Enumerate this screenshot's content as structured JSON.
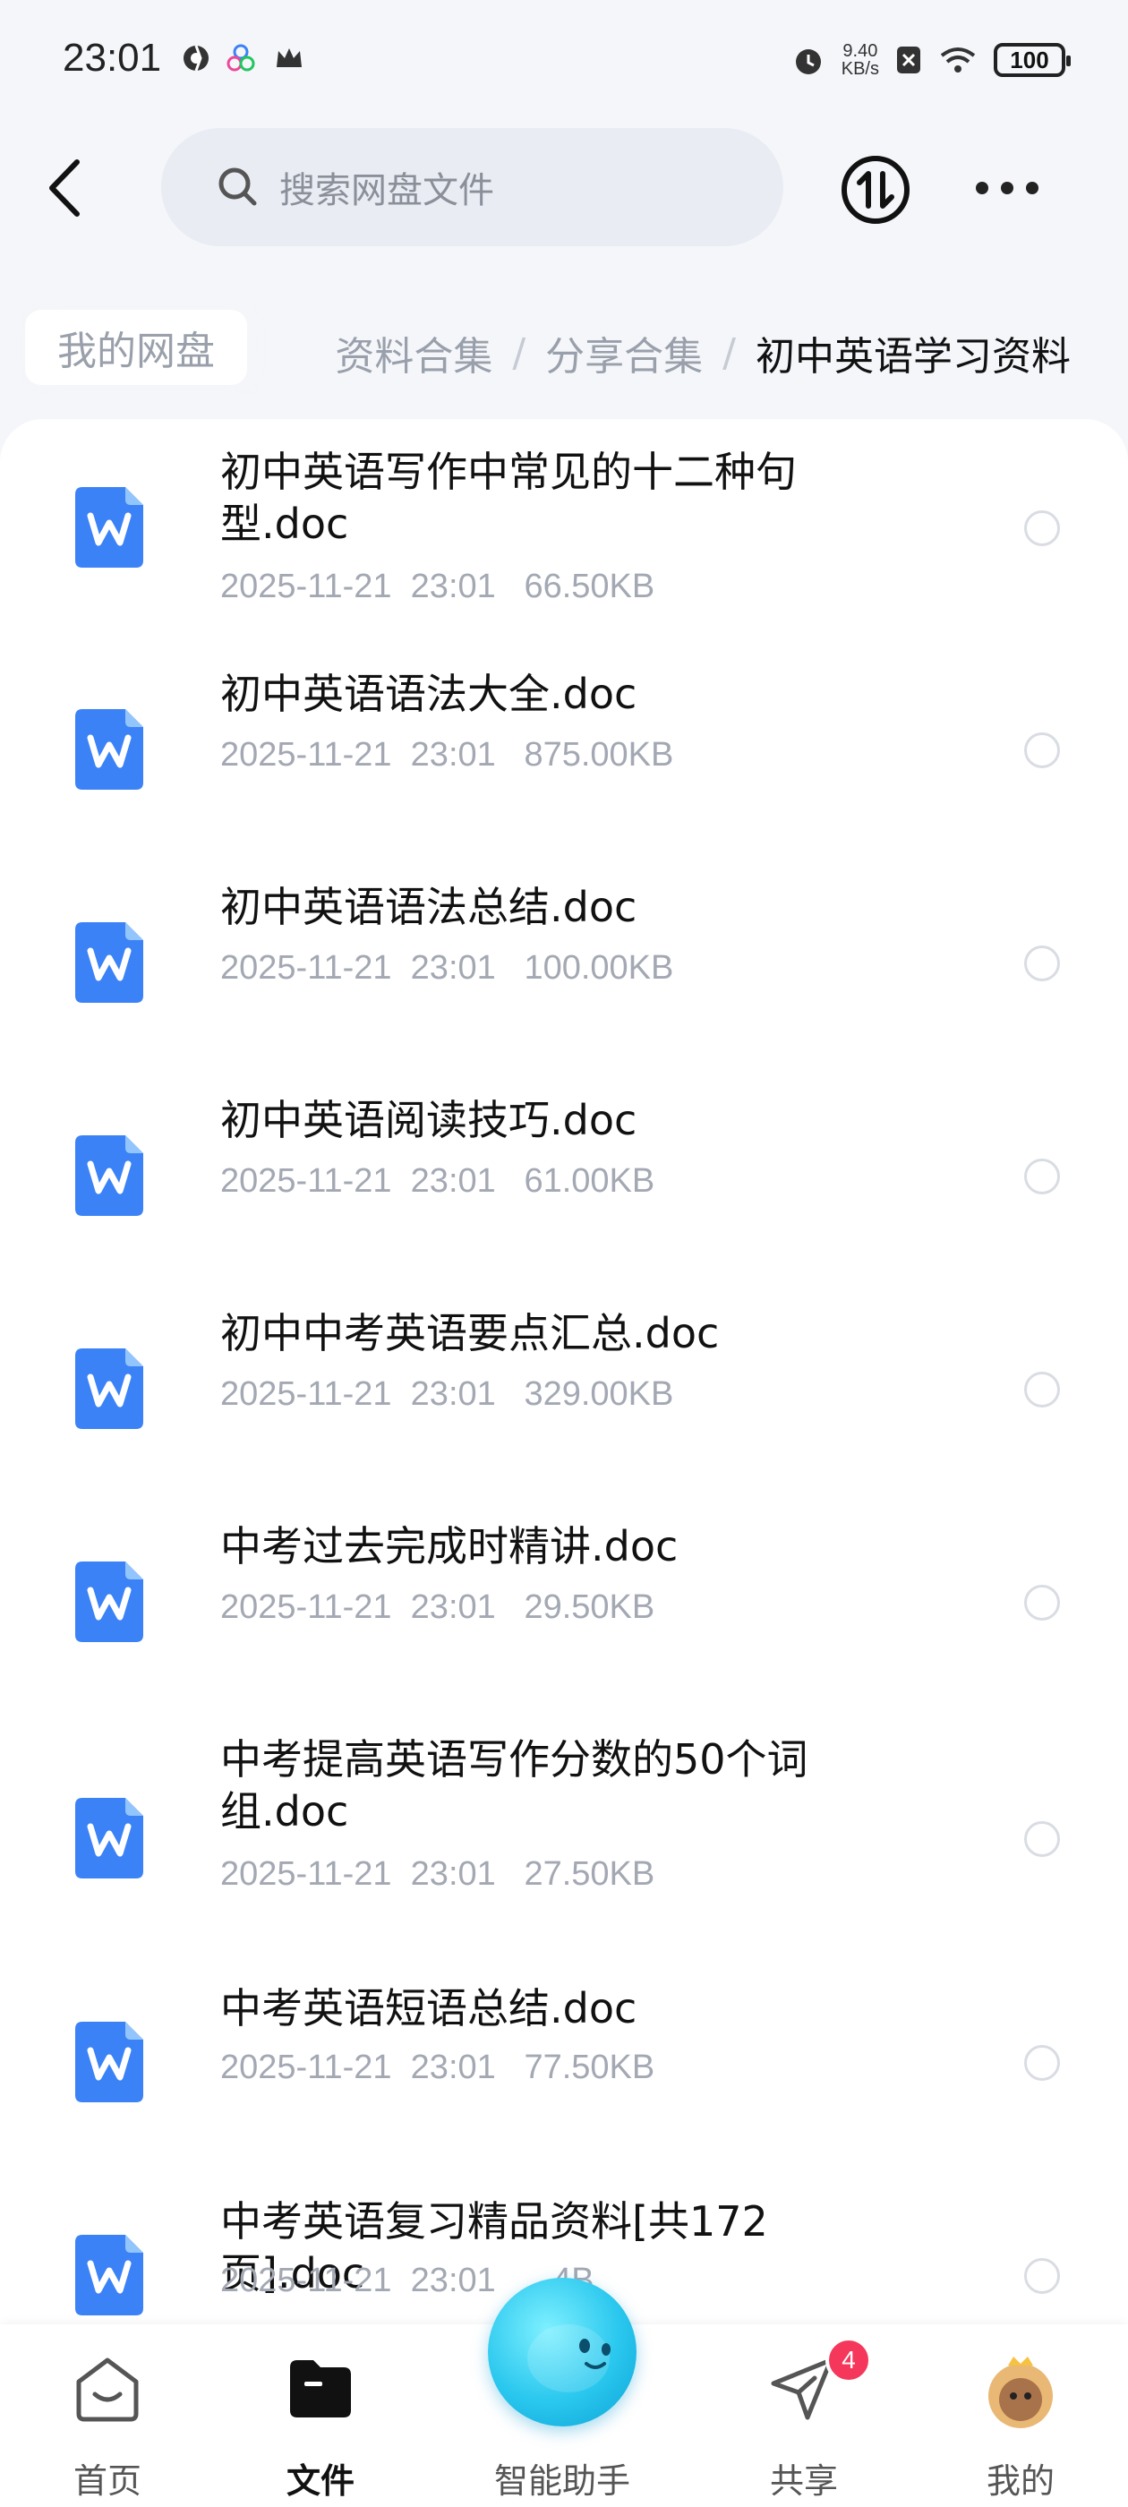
{
  "status_bar": {
    "time": "23:01",
    "net_speed_value": "9.40",
    "net_speed_unit": "KB/s",
    "battery": "100"
  },
  "header": {
    "search_placeholder": "搜索网盘文件",
    "back_icon": "back-arrow-icon",
    "sort_icon": "transfer-icon",
    "more_icon": "more-icon"
  },
  "breadcrumb": {
    "root": "我的网盘",
    "items": [
      "资料合集",
      "分享合集"
    ],
    "separator": "/",
    "current": "初中英语学习资料"
  },
  "files": [
    {
      "name": "初中英语写作中常见的十二种句型.doc",
      "meta": "2025-11-21  23:01   66.50KB"
    },
    {
      "name": "初中英语语法大全.doc",
      "meta": "2025-11-21  23:01   875.00KB"
    },
    {
      "name": "初中英语语法总结.doc",
      "meta": "2025-11-21  23:01   100.00KB"
    },
    {
      "name": "初中英语阅读技巧.doc",
      "meta": "2025-11-21  23:01   61.00KB"
    },
    {
      "name": "初中中考英语要点汇总.doc",
      "meta": "2025-11-21  23:01   329.00KB"
    },
    {
      "name": "中考过去完成时精讲.doc",
      "meta": "2025-11-21  23:01   29.50KB"
    },
    {
      "name": "中考提高英语写作分数的50个词组.doc",
      "meta": "2025-11-21  23:01   27.50KB"
    },
    {
      "name": "中考英语短语总结.doc",
      "meta": "2025-11-21  23:01   77.50KB"
    },
    {
      "name": "中考英语复习精品资料[共172页].doc",
      "meta": "2025-11-21  23:01   ...4B"
    }
  ],
  "bottom_nav": {
    "home": "首页",
    "files": "文件",
    "assistant": "智能助手",
    "share": "共享",
    "share_badge": "4",
    "me": "我的"
  },
  "colors": {
    "accent": "#3b82f6",
    "badge": "#f4375b",
    "assistant": "#2ac7ee"
  }
}
